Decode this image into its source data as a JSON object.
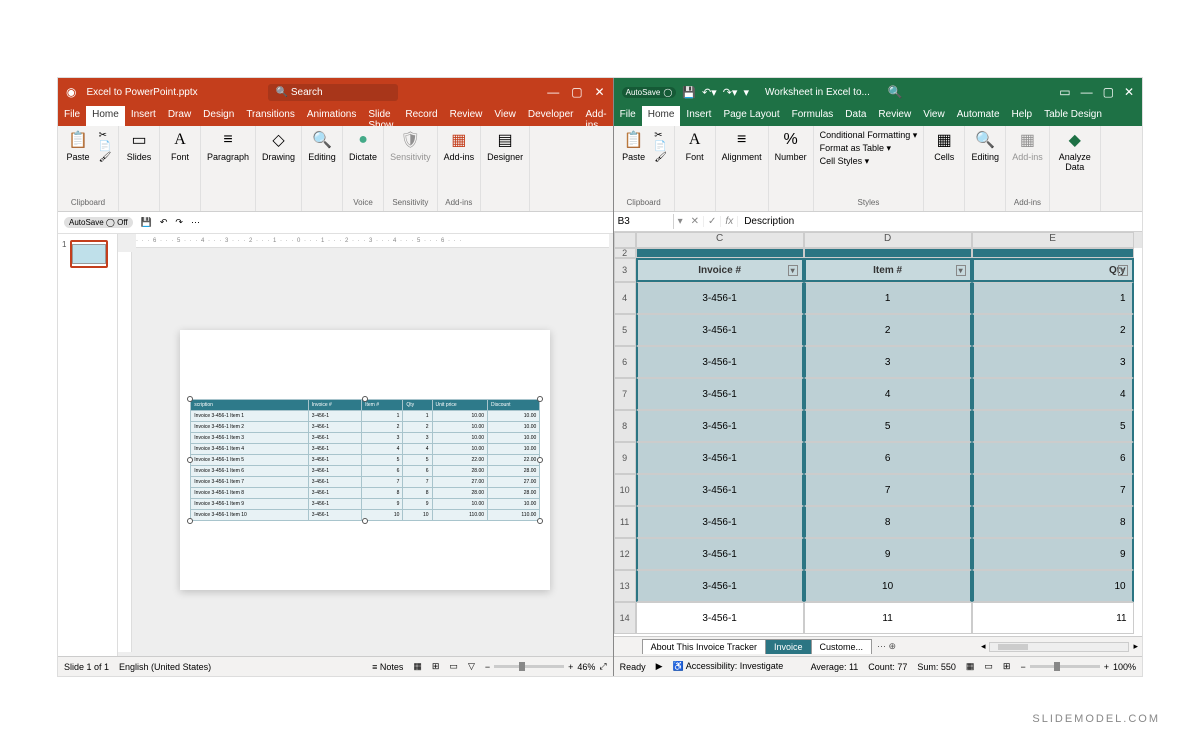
{
  "powerpoint": {
    "title": "Excel to PowerPoint.pptx",
    "search_placeholder": "Search",
    "window_controls": {
      "min": "—",
      "max": "▢",
      "close": "✕"
    },
    "tabs": [
      "File",
      "Home",
      "Insert",
      "Draw",
      "Design",
      "Transitions",
      "Animations",
      "Slide Show",
      "Record",
      "Review",
      "View",
      "Developer",
      "Add-ins"
    ],
    "active_tab": "Home",
    "ribbon": {
      "clipboard": {
        "paste": "Paste",
        "label": "Clipboard"
      },
      "slides": {
        "btn": "Slides",
        "label": ""
      },
      "font": {
        "btn": "Font",
        "label": ""
      },
      "paragraph": {
        "btn": "Paragraph",
        "label": ""
      },
      "drawing": {
        "btn": "Drawing",
        "label": ""
      },
      "editing": {
        "btn": "Editing",
        "label": ""
      },
      "dictate": {
        "btn": "Dictate",
        "label": "Voice"
      },
      "sensitivity": {
        "btn": "Sensitivity",
        "label": "Sensitivity"
      },
      "addins": {
        "btn": "Add-ins",
        "label": "Add-ins"
      },
      "designer": {
        "btn": "Designer",
        "label": ""
      }
    },
    "qat": {
      "autosave": "AutoSave",
      "autosave_state": "Off"
    },
    "thumb_num": "1",
    "ruler_text": "· · · 6 · · · 5 · · · 4 · · · 3 · · · 2 · · · 1 · · · 0 · · · 1 · · · 2 · · · 3 · · · 4 · · · 5 · · · 6 · · ·",
    "slide_table": {
      "headers": [
        "scription",
        "Invoice #",
        "Item #",
        "Qty",
        "Unit price",
        "Discount"
      ],
      "rows": [
        [
          "Invoice 3-456-1 Item 1",
          "3-456-1",
          "1",
          "1",
          "10.00",
          "10.00"
        ],
        [
          "Invoice 3-456-1 Item 2",
          "3-456-1",
          "2",
          "2",
          "10.00",
          "10.00"
        ],
        [
          "Invoice 3-456-1 Item 3",
          "3-456-1",
          "3",
          "3",
          "10.00",
          "10.00"
        ],
        [
          "Invoice 3-456-1 Item 4",
          "3-456-1",
          "4",
          "4",
          "10.00",
          "10.00"
        ],
        [
          "Invoice 3-456-1 Item 5",
          "3-456-1",
          "5",
          "5",
          "22.00",
          "22.00"
        ],
        [
          "Invoice 3-456-1 Item 6",
          "3-456-1",
          "6",
          "6",
          "28.00",
          "28.00"
        ],
        [
          "Invoice 3-456-1 Item 7",
          "3-456-1",
          "7",
          "7",
          "27.00",
          "27.00"
        ],
        [
          "Invoice 3-456-1 Item 8",
          "3-456-1",
          "8",
          "8",
          "28.00",
          "28.00"
        ],
        [
          "Invoice 3-456-1 Item 9",
          "3-456-1",
          "9",
          "9",
          "10.00",
          "10.00"
        ],
        [
          "Invoice 3-456-1 Item 10",
          "3-456-1",
          "10",
          "10",
          "110.00",
          "110.00"
        ]
      ]
    },
    "status": {
      "slide": "Slide 1 of 1",
      "lang": "English (United States)",
      "notes": "Notes",
      "zoom": "46%"
    }
  },
  "excel": {
    "title": "Worksheet in Excel to...",
    "autosave": "AutoSave",
    "window_controls": {
      "min": "—",
      "max": "▢",
      "close": "✕"
    },
    "tabs": [
      "File",
      "Home",
      "Insert",
      "Page Layout",
      "Formulas",
      "Data",
      "Review",
      "View",
      "Automate",
      "Help",
      "Table Design"
    ],
    "active_tab": "Home",
    "ribbon": {
      "clipboard": {
        "paste": "Paste",
        "label": "Clipboard"
      },
      "font": {
        "btn": "Font",
        "label": ""
      },
      "alignment": {
        "btn": "Alignment",
        "label": ""
      },
      "number": {
        "btn": "Number",
        "label": ""
      },
      "styles": {
        "cond": "Conditional Formatting ▾",
        "table": "Format as Table ▾",
        "cell": "Cell Styles ▾",
        "label": "Styles"
      },
      "cells": {
        "btn": "Cells",
        "label": ""
      },
      "editing": {
        "btn": "Editing",
        "label": ""
      },
      "addins": {
        "btn": "Add-ins",
        "label": "Add-ins"
      },
      "analyze": {
        "btn": "Analyze Data",
        "label": ""
      }
    },
    "namebox": "B3",
    "formula": "Description",
    "cols": [
      "C",
      "D",
      "E"
    ],
    "headers_row": {
      "C": "Invoice #",
      "D": "Item #",
      "E": "Qty"
    },
    "rows": [
      {
        "n": 2,
        "top": true
      },
      {
        "n": 3,
        "hdr": true
      },
      {
        "n": 4,
        "C": "3-456-1",
        "D": "1",
        "E": "1"
      },
      {
        "n": 5,
        "C": "3-456-1",
        "D": "2",
        "E": "2"
      },
      {
        "n": 6,
        "C": "3-456-1",
        "D": "3",
        "E": "3"
      },
      {
        "n": 7,
        "C": "3-456-1",
        "D": "4",
        "E": "4"
      },
      {
        "n": 8,
        "C": "3-456-1",
        "D": "5",
        "E": "5"
      },
      {
        "n": 9,
        "C": "3-456-1",
        "D": "6",
        "E": "6"
      },
      {
        "n": 10,
        "C": "3-456-1",
        "D": "7",
        "E": "7"
      },
      {
        "n": 11,
        "C": "3-456-1",
        "D": "8",
        "E": "8"
      },
      {
        "n": 12,
        "C": "3-456-1",
        "D": "9",
        "E": "9"
      },
      {
        "n": 13,
        "C": "3-456-1",
        "D": "10",
        "E": "10"
      },
      {
        "n": 14,
        "C": "3-456-1",
        "D": "11",
        "E": "11",
        "white": true
      }
    ],
    "sheets": {
      "tabs": [
        "About This Invoice Tracker",
        "Invoice",
        "Custome..."
      ],
      "active": "Invoice"
    },
    "status": {
      "ready": "Ready",
      "access": "Accessibility: Investigate",
      "avg": "Average: 11",
      "count": "Count: 77",
      "sum": "Sum: 550",
      "zoom": "100%"
    }
  },
  "attribution": "SLIDEMODEL.COM"
}
